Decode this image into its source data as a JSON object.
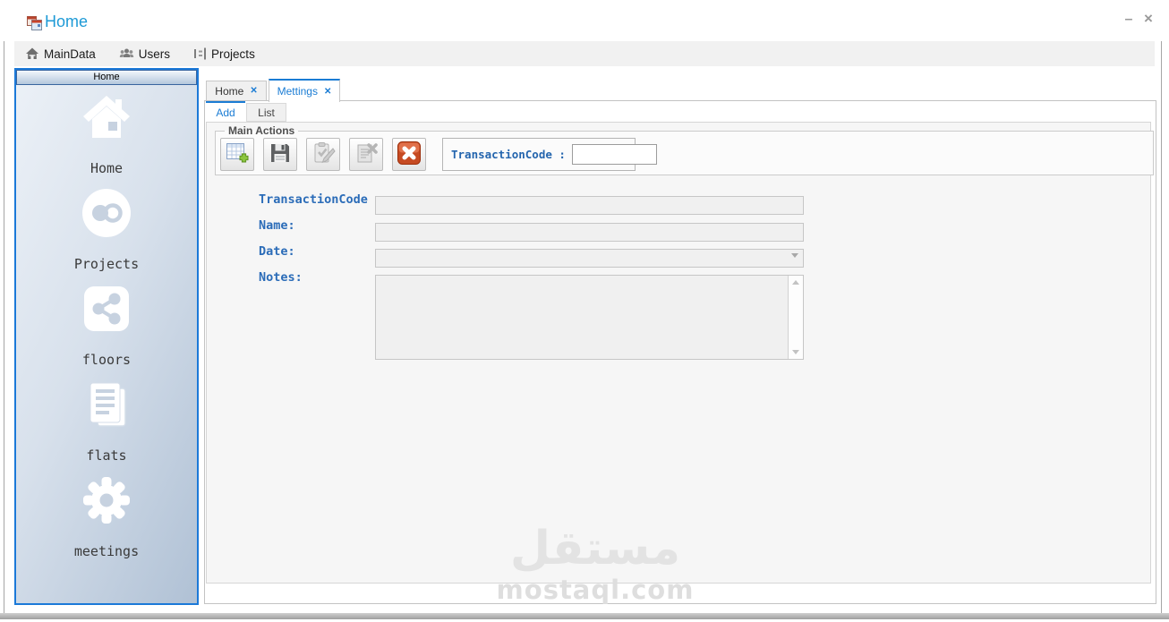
{
  "window": {
    "title": "Home",
    "minimize_glyph": "–",
    "close_glyph": "×"
  },
  "menubar": {
    "items": [
      {
        "label": "MainData",
        "icon": "home-icon"
      },
      {
        "label": "Users",
        "icon": "users-icon"
      },
      {
        "label": "Projects",
        "icon": "hierarchy-icon"
      }
    ]
  },
  "sidebar": {
    "header": "Home",
    "items": [
      {
        "label": "Home",
        "icon": "house-icon"
      },
      {
        "label": "Projects",
        "icon": "circles-icon"
      },
      {
        "label": "floors",
        "icon": "share-icon"
      },
      {
        "label": "flats",
        "icon": "pages-icon"
      },
      {
        "label": "meetings",
        "icon": "gear-icon"
      }
    ]
  },
  "tabs": {
    "home": {
      "label": "Home",
      "close_glyph": "✕"
    },
    "mettings": {
      "label": "Mettings",
      "close_glyph": "✕"
    }
  },
  "subtabs": {
    "add": "Add",
    "list": "List"
  },
  "main_actions": {
    "title": "Main Actions",
    "buttons": [
      "add-record",
      "save",
      "validate",
      "delete-record",
      "cancel"
    ],
    "toolbar_field": {
      "label": "TransactionCode :",
      "value": ""
    }
  },
  "form": {
    "transaction_code": {
      "label": "TransactionCode :",
      "value": ""
    },
    "name": {
      "label": "Name:",
      "value": ""
    },
    "date": {
      "label": "Date:",
      "value": ""
    },
    "notes": {
      "label": "Notes:",
      "value": ""
    }
  },
  "watermark": {
    "arabic": "مستقل",
    "latin": "mostaql.com"
  },
  "colors": {
    "accent_blue": "#1a7cd4",
    "title_blue": "#1e9ad6",
    "form_label_blue": "#2b6cb8",
    "sidebar_border_blue": "#1b79d8",
    "cancel_red": "#c64a22",
    "add_green": "#8bc53f"
  }
}
